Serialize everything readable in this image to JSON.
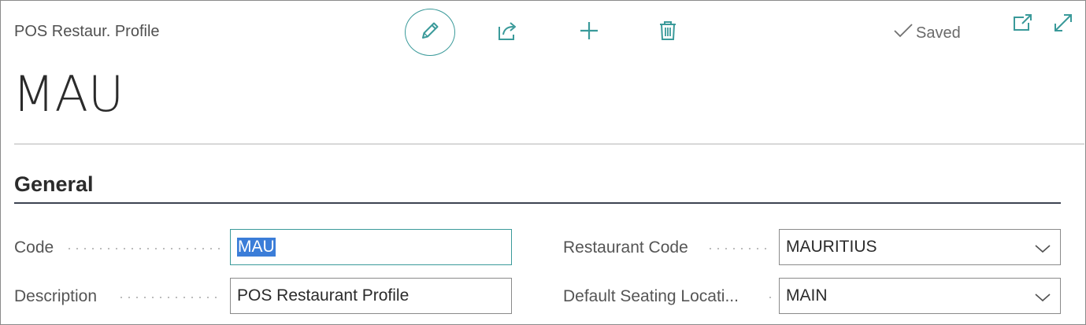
{
  "header": {
    "caption": "POS Restaur. Profile",
    "status": "Saved",
    "icons": {
      "edit": "pencil-icon",
      "share": "share-icon",
      "add": "plus-icon",
      "delete": "trash-icon",
      "saved": "checkmark-icon",
      "popout": "open-new-window-icon",
      "expand": "expand-icon"
    }
  },
  "title": "MAU",
  "section": {
    "title": "General",
    "fields": {
      "code": {
        "label": "Code",
        "value": "MAU"
      },
      "description": {
        "label": "Description",
        "value": "POS Restaurant Profile"
      },
      "restaurant_code": {
        "label": "Restaurant Code",
        "value": "MAURITIUS"
      },
      "default_seating_location": {
        "label": "Default Seating Locati...",
        "value": "MAIN"
      }
    }
  },
  "colors": {
    "accent": "#3a9a9a",
    "selection": "#3b7dd8",
    "section_line": "#3d4452"
  }
}
